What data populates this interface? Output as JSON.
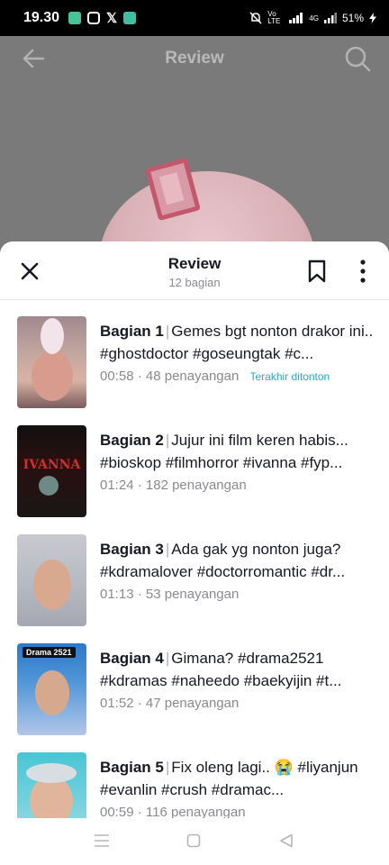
{
  "status_bar": {
    "time": "19.30",
    "network": "Vo LTE",
    "signal": "4G",
    "battery": "51%"
  },
  "header": {
    "title": "Review"
  },
  "sheet": {
    "title": "Review",
    "subtitle": "12 bagian"
  },
  "episodes": [
    {
      "part": "Bagian 1",
      "text": "Gemes bgt nonton drakor ini.. #ghostdoctor #goseungtak #c...",
      "duration": "00:58",
      "views": "48 penayangan",
      "badge": "Terakhir ditonton"
    },
    {
      "part": "Bagian 2",
      "text": "Jujur ini film keren habis... #bioskop #filmhorror #ivanna #fyp...",
      "duration": "01:24",
      "views": "182 penayangan",
      "badge": ""
    },
    {
      "part": "Bagian 3",
      "text": "Ada gak yg nonton juga? #kdramalover #doctorromantic #dr...",
      "duration": "01:13",
      "views": "53 penayangan",
      "badge": ""
    },
    {
      "part": "Bagian 4",
      "text": "Gimana? #drama2521 #kdramas #naheedo #baekyijin #t...",
      "duration": "01:52",
      "views": "47 penayangan",
      "badge": ""
    },
    {
      "part": "Bagian 5",
      "text": "Fix oleng lagi.. 😭 #liyanjun #evanlin #crush #dramac...",
      "duration": "00:59",
      "views": "116 penayangan",
      "badge": ""
    }
  ],
  "thumb_texts": {
    "ivanna": "IVANNA",
    "drama": "Drama 2521"
  },
  "meta_sep": "·",
  "title_sep": "|",
  "icons": [
    "back-arrow-icon",
    "search-icon",
    "close-icon",
    "bookmark-icon",
    "more-vertical-icon",
    "menu-icon",
    "home-square-icon",
    "back-triangle-icon"
  ]
}
